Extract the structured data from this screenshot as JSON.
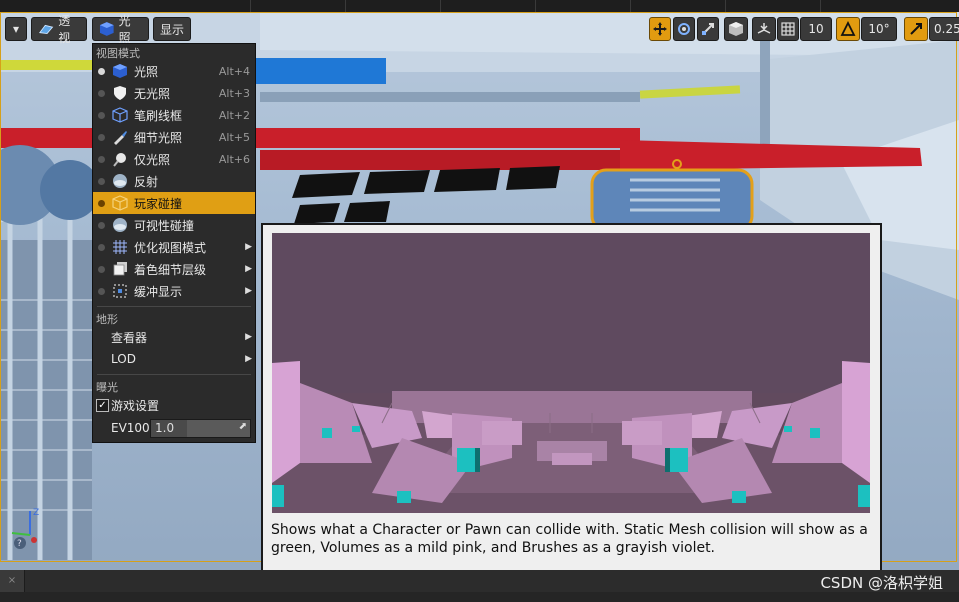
{
  "toolbar": {
    "menu_chevron": "▾",
    "perspective_label": "透视",
    "lighting_label": "光照",
    "show_label": "显示",
    "grid_snap_value": "10",
    "rotation_snap_value": "10°",
    "scale_snap_value": "0.25"
  },
  "menu": {
    "section_view_mode": "视图模式",
    "items": [
      {
        "label": "光照",
        "shortcut": "Alt+4",
        "icon": "lit-cube-icon"
      },
      {
        "label": "无光照",
        "shortcut": "Alt+3",
        "icon": "unlit-shield-icon"
      },
      {
        "label": "笔刷线框",
        "shortcut": "Alt+2",
        "icon": "wireframe-cube-icon"
      },
      {
        "label": "细节光照",
        "shortcut": "Alt+5",
        "icon": "detail-lighting-icon"
      },
      {
        "label": "仅光照",
        "shortcut": "Alt+6",
        "icon": "lighting-only-icon"
      },
      {
        "label": "反射",
        "shortcut": "",
        "icon": "reflection-sphere-icon"
      },
      {
        "label": "玩家碰撞",
        "shortcut": "",
        "icon": "player-collision-icon"
      },
      {
        "label": "可视性碰撞",
        "shortcut": "",
        "icon": "visibility-collision-icon"
      },
      {
        "label": "优化视图模式",
        "shortcut": "",
        "icon": "optimization-grid-icon"
      },
      {
        "label": "着色细节层级",
        "shortcut": "",
        "icon": "shading-lod-icon"
      },
      {
        "label": "缓冲显示",
        "shortcut": "",
        "icon": "buffer-visualization-icon"
      }
    ],
    "section_landscape": "地形",
    "viewer_label": "查看器",
    "lod_label": "LOD",
    "section_exposure": "曝光",
    "game_settings_label": "游戏设置",
    "ev100_label": "EV100",
    "ev100_value": "1.0"
  },
  "tooltip": {
    "description": "Shows what a Character or Pawn can collide with. Static Mesh collision will show as a green, Volumes as a mild pink, and Brushes as a grayish violet."
  },
  "bottom_tab_close": "×",
  "watermark": "CSDN @洛枳学姐",
  "colors": {
    "selection": "#e09f14",
    "menu_bg": "#2b2b2b",
    "collision_pink": "#c89ac8",
    "collision_cyan": "#1cc0c0"
  }
}
